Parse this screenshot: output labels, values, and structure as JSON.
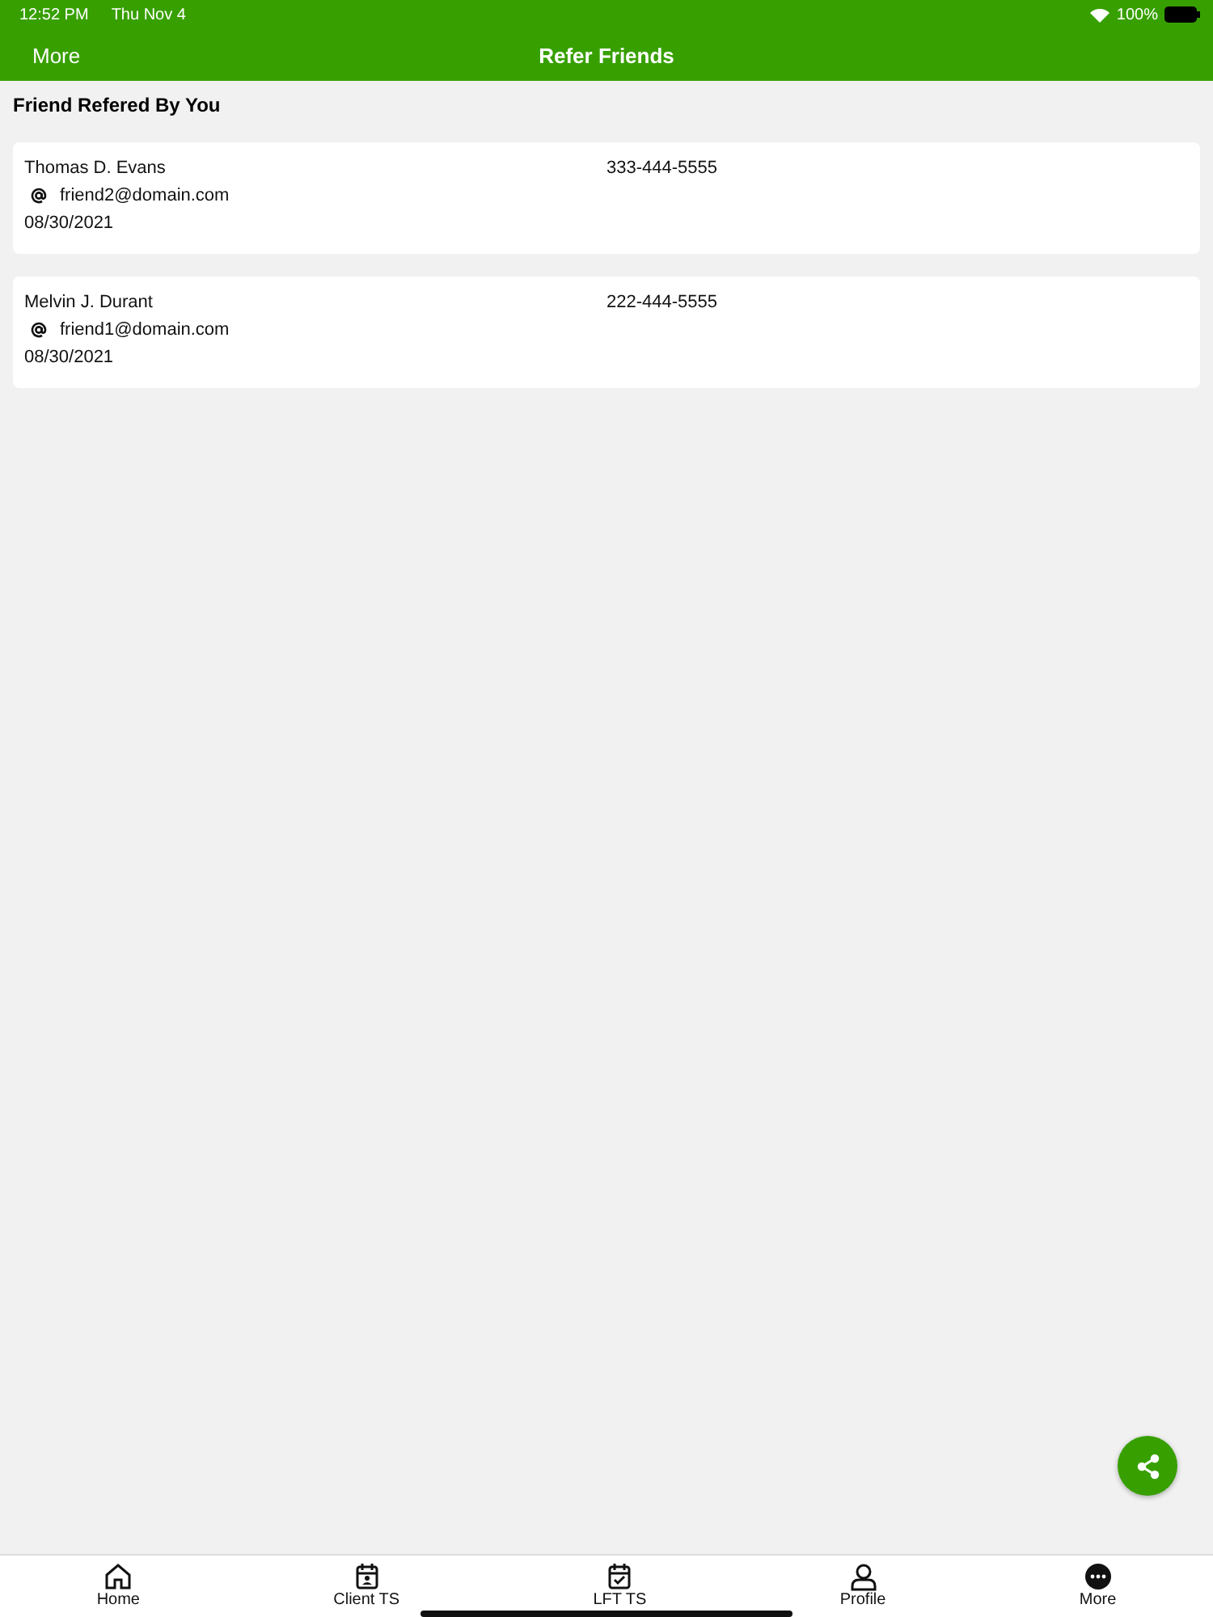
{
  "status_bar": {
    "time": "12:52 PM",
    "date": "Thu Nov 4",
    "battery": "100%"
  },
  "nav": {
    "back": "More",
    "title": "Refer Friends"
  },
  "section_title": "Friend Refered By You",
  "friends": [
    {
      "name": "Thomas D. Evans",
      "phone": "333-444-5555",
      "email": "friend2@domain.com",
      "date": "08/30/2021"
    },
    {
      "name": "Melvin J. Durant",
      "phone": "222-444-5555",
      "email": "friend1@domain.com",
      "date": "08/30/2021"
    }
  ],
  "tabs": [
    {
      "label": "Home",
      "kind": "home"
    },
    {
      "label": "Client TS",
      "kind": "client"
    },
    {
      "label": "LFT TS",
      "kind": "check"
    },
    {
      "label": "Profile",
      "kind": "profile"
    },
    {
      "label": "More",
      "kind": "more"
    }
  ]
}
